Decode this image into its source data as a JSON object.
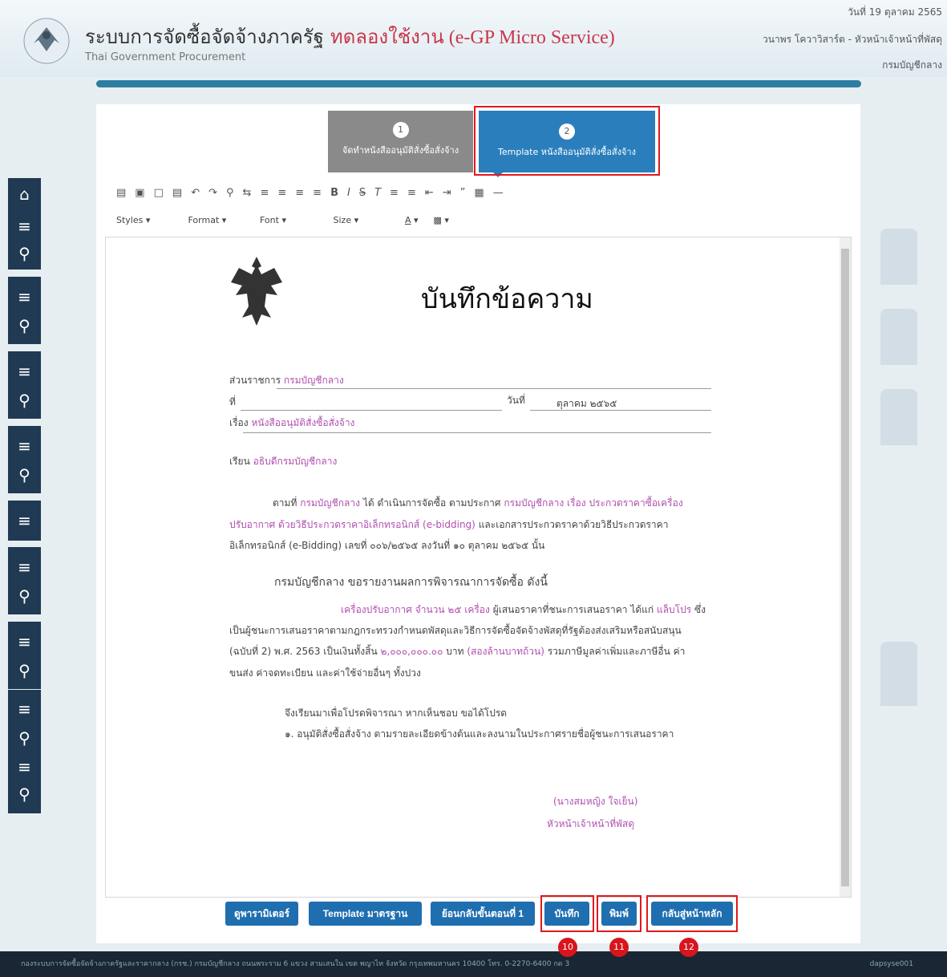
{
  "header": {
    "title": "ระบบการจัดซื้อจัดจ้างภาครัฐ",
    "trial": "ทดลองใช้งาน (e-GP Micro Service)",
    "subtitle": "Thai Government Procurement",
    "date": "วันที่ 19 ตุลาคม 2565",
    "user": "วนาพร โควาวิสาร์ต - หัวหน้าเจ้าหน้าที่พัสดุ",
    "dept": "กรมบัญชีกลาง"
  },
  "steps": [
    {
      "num": "1",
      "label": "จัดทำหนังสืออนุมัติสั่งซื้อสั่งจ้าง",
      "active": false
    },
    {
      "num": "2",
      "label": "Template หนังสืออนุมัติสั่งซื้อสั่งจ้าง",
      "active": true
    }
  ],
  "toolbar": {
    "styles": "Styles",
    "format": "Format",
    "font": "Font",
    "size": "Size",
    "icons": [
      "source-icon",
      "preview-icon",
      "copy-icon",
      "paste-icon",
      "undo-icon",
      "redo-icon",
      "find-icon",
      "replace-icon",
      "align-left-icon",
      "align-center-icon",
      "align-right-icon",
      "justify-icon",
      "bold-icon",
      "italic-icon",
      "strike-icon",
      "clear-format-icon",
      "ordered-list-icon",
      "bullet-list-icon",
      "outdent-icon",
      "indent-icon",
      "blockquote-icon",
      "table-icon",
      "hr-icon"
    ]
  },
  "document": {
    "heading": "บันทึกข้อความ",
    "office_label": "ส่วนราชการ",
    "office": "กรมบัญชีกลาง",
    "ref_label": "ที่",
    "date_label": "วันที่",
    "date": "ตุลาคม ๒๕๖๕",
    "subject_label": "เรื่อง",
    "subject": "หนังสืออนุมัติสั่งซื้อสั่งจ้าง",
    "to_label": "เรียน",
    "to": "อธิบดีกรมบัญชีกลาง",
    "p1a": "ตามที่",
    "p1b": "กรมบัญชีกลาง",
    "p1c": "ได้ ดำเนินการจัดซื้อ ตามประกาศ",
    "p1d": "กรมบัญชีกลาง เรื่อง ประกวดราคาซื้อเครื่อง",
    "p1e": "ปรับอากาศ ด้วยวิธีประกวดราคาอิเล็กทรอนิกส์ (e-bidding)",
    "p1f": "และเอกสารประกวดราคาด้วยวิธีประกวดราคา",
    "p1g": "อิเล็กทรอนิกส์ (e-Bidding) เลขที่ ๐๐๖/๒๕๖๕ ลงวันที่ ๑๐ ตุลาคม ๒๕๖๕ นั้น",
    "p2": "กรมบัญชีกลาง ขอรายงานผลการพิจารณาการจัดซื้อ ดังนี้",
    "p3a": "เครื่องปรับอากาศ จำนวน ๒๕ เครื่อง",
    "p3b": "ผู้เสนอราคาที่ชนะการเสนอราคา ได้แก่",
    "p3c": "แล็บโปร",
    "p3d": "ซึ่ง",
    "p3e": "เป็นผู้ชนะการเสนอราคาตามกฎกระทรวงกำหนดพัสดุและวิธีการจัดซื้อจัดจ้างพัสดุที่รัฐต้องส่งเสริมหรือสนับสนุน",
    "p3f": "(ฉบับที่ 2) พ.ศ. 2563 เป็นเงินทั้งสิ้น",
    "p3g": "๒,๐๐๐,๐๐๐.๐๐",
    "p3h": "บาท",
    "p3i": "(สองล้านบาทถ้วน)",
    "p3j": "รวมภาษีมูลค่าเพิ่มและภาษีอื่น ค่า",
    "p3k": "ขนส่ง ค่าจดทะเบียน และค่าใช้จ่ายอื่นๆ ทั้งปวง",
    "p4": "จึงเรียนมาเพื่อโปรดพิจารณา หากเห็นชอบ ขอได้โปรด",
    "p5": "๑. อนุมัติสั่งซื้อสั่งจ้าง ตามรายละเอียดข้างต้นและลงนามในประกาศรายชื่อผู้ชนะการเสนอราคา",
    "signer": "(นางสมหญิง ใจเย็น)",
    "signer_title": "หัวหน้าเจ้าหน้าที่พัสดุ"
  },
  "buttons": {
    "params": "ดูพารามิเตอร์",
    "template": "Template มาตรฐาน",
    "back": "ย้อนกลับขั้นตอนที่ 1",
    "save": "บันทึก",
    "print": "พิมพ์",
    "home": "กลับสู่หน้าหลัก"
  },
  "badges": [
    "10",
    "11",
    "12"
  ],
  "footer": {
    "text": "กองระบบการจัดซื้อจัดจ้างภาครัฐและราคากลาง (กรช.) กรมบัญชีกลาง ถนนพระราม 6 แขวง สามเสนใน เขต พญาไท จังหวัด กรุงเทพมหานคร 10400 โทร. 0-2270-6400 กด 3",
    "user": "dapsyse001"
  },
  "colors": {
    "accent": "#1f6eb0",
    "step_active": "#2a7ebc",
    "step_inactive": "#8a8a8a",
    "highlight": "#e0191c",
    "magenta": "#b04fae",
    "sidebar": "#1f3a52"
  }
}
